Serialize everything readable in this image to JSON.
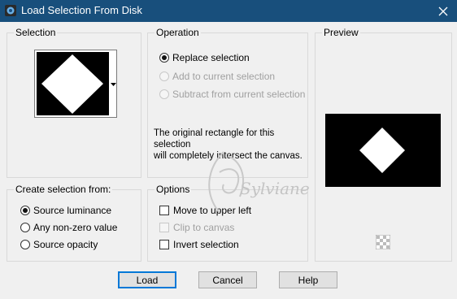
{
  "window": {
    "title": "Load Selection From Disk",
    "close_icon": "close-icon"
  },
  "selection_group": {
    "label": "Selection",
    "thumbnail_icon": "diamond-shape-preview"
  },
  "operation_group": {
    "label": "Operation",
    "options": [
      {
        "label": "Replace selection",
        "checked": true,
        "enabled": true
      },
      {
        "label": "Add to current selection",
        "checked": false,
        "enabled": false
      },
      {
        "label": "Subtract from current selection",
        "checked": false,
        "enabled": false
      }
    ],
    "info_line1": "The original rectangle for this selection",
    "info_line2": "will completely intersect the canvas."
  },
  "preview_group": {
    "label": "Preview",
    "transparency_icon": "checkerboard-icon"
  },
  "create_group": {
    "label": "Create selection from:",
    "options": [
      {
        "label": "Source luminance",
        "checked": true
      },
      {
        "label": "Any non-zero value",
        "checked": false
      },
      {
        "label": "Source opacity",
        "checked": false
      }
    ]
  },
  "options_group": {
    "label": "Options",
    "items": [
      {
        "label": "Move to upper left",
        "checked": false,
        "enabled": true
      },
      {
        "label": "Clip to canvas",
        "checked": false,
        "enabled": false
      },
      {
        "label": "Invert selection",
        "checked": false,
        "enabled": true
      }
    ]
  },
  "buttons": {
    "load": "Load",
    "cancel": "Cancel",
    "help": "Help"
  },
  "watermark": "Sylviane",
  "colors": {
    "titlebar": "#184f7c",
    "preview_bg": "#000000",
    "default_button_border": "#0078d7"
  }
}
